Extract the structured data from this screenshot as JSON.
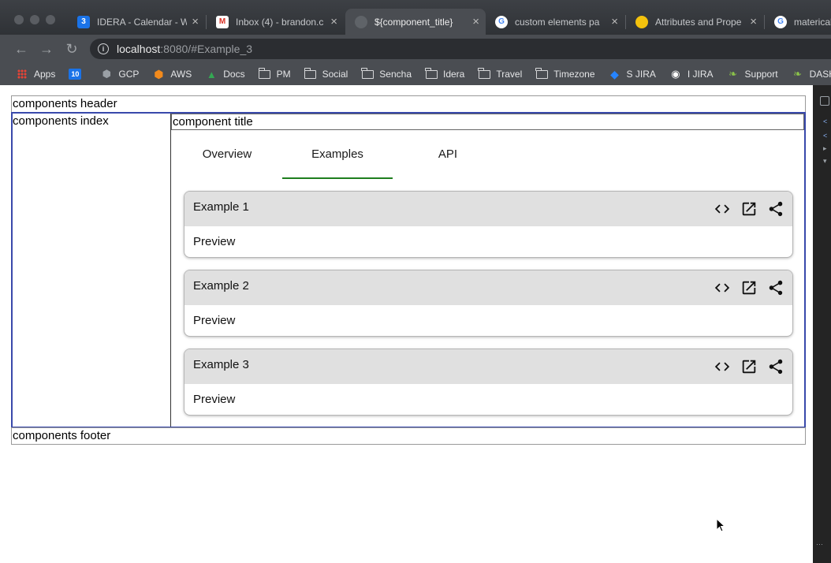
{
  "browser": {
    "tabs": [
      {
        "label": "IDERA - Calendar - W",
        "favicon_color": "#1a73e8",
        "favicon_text": "3"
      },
      {
        "label": "Inbox (4) - brandon.c",
        "favicon_color": "#ffffff",
        "favicon_text": "M"
      },
      {
        "label": "${component_title}",
        "favicon_color": "#5f6368",
        "favicon_text": ""
      },
      {
        "label": "custom elements pa",
        "favicon_color": "#ffffff",
        "favicon_text": "G"
      },
      {
        "label": "Attributes and Prope",
        "favicon_color": "#f4c20d",
        "favicon_text": ""
      },
      {
        "label": "materical",
        "favicon_color": "#ffffff",
        "favicon_text": "G"
      }
    ],
    "url_host": "localhost",
    "url_path": ":8080/#Example_3",
    "bookmarks": [
      {
        "label": "Apps",
        "icon": "apps-grid-icon"
      },
      {
        "label": "",
        "icon": "calendar-icon",
        "icon_text": "10"
      },
      {
        "label": "GCP",
        "icon": "gcp-icon"
      },
      {
        "label": "AWS",
        "icon": "aws-icon"
      },
      {
        "label": "Docs",
        "icon": "drive-icon"
      },
      {
        "label": "PM",
        "icon": "folder-icon"
      },
      {
        "label": "Social",
        "icon": "folder-icon"
      },
      {
        "label": "Sencha",
        "icon": "folder-icon"
      },
      {
        "label": "Idera",
        "icon": "folder-icon"
      },
      {
        "label": "Travel",
        "icon": "folder-icon"
      },
      {
        "label": "Timezone",
        "icon": "folder-icon"
      },
      {
        "label": "S JIRA",
        "icon": "jira-icon"
      },
      {
        "label": "I JIRA",
        "icon": "globe-icon"
      },
      {
        "label": "Support",
        "icon": "leaf-icon"
      },
      {
        "label": "DASH",
        "icon": "leaf-icon"
      }
    ]
  },
  "page": {
    "header": "components header",
    "index": "components index",
    "title": "component title",
    "footer": "components footer",
    "tabs": [
      {
        "label": "Overview",
        "active": false
      },
      {
        "label": "Examples",
        "active": true
      },
      {
        "label": "API",
        "active": false
      }
    ],
    "examples": [
      {
        "title": "Example 1",
        "preview": "Preview"
      },
      {
        "title": "Example 2",
        "preview": "Preview"
      },
      {
        "title": "Example 3",
        "preview": "Preview"
      }
    ]
  },
  "colors": {
    "active_tab_underline": "#1e7e1e",
    "body_border": "#3949ab",
    "card_header": "#e0e0e0"
  }
}
